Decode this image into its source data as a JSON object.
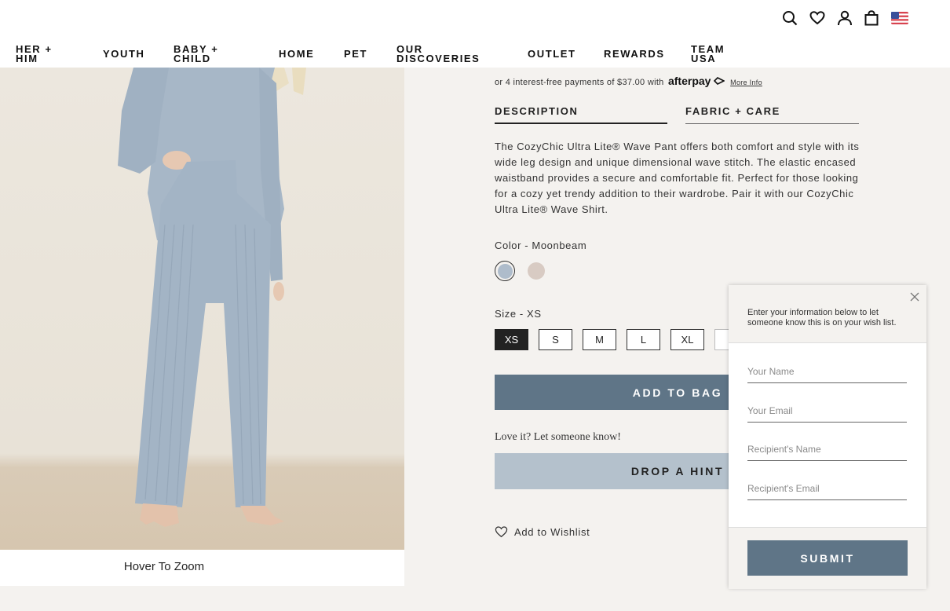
{
  "header": {
    "icons": [
      "search-icon",
      "heart-icon",
      "account-icon",
      "bag-icon",
      "us-flag-icon"
    ],
    "nav": [
      {
        "line1": "HER +",
        "line2": "HIM"
      },
      {
        "line1": "YOUTH",
        "line2": ""
      },
      {
        "line1": "BABY +",
        "line2": "CHILD"
      },
      {
        "line1": "HOME",
        "line2": ""
      },
      {
        "line1": "PET",
        "line2": ""
      },
      {
        "line1": "OUR",
        "line2": "DISCOVERIES"
      },
      {
        "line1": "OUTLET",
        "line2": ""
      },
      {
        "line1": "REWARDS",
        "line2": ""
      },
      {
        "line1": "TEAM",
        "line2": "USA"
      }
    ]
  },
  "gallery": {
    "hover_text": "Hover To Zoom"
  },
  "product": {
    "payments_text": "or 4 interest-free payments of $37.00 with",
    "afterpay": "afterpay",
    "more_info": "More Info",
    "tabs": [
      "DESCRIPTION",
      "FABRIC + CARE"
    ],
    "description": "The CozyChic Ultra Lite® Wave Pant offers both comfort and style with its wide leg design and unique dimensional wave stitch. The elastic encased waistband provides a secure and comfortable fit. Perfect for those looking for a cozy yet trendy addition to their wardrobe. Pair it with our CozyChic Ultra Lite® Wave Shirt.",
    "color_label": "Color - Moonbeam",
    "colors": [
      {
        "name": "moonbeam",
        "hex": "#aebccb",
        "selected": true
      },
      {
        "name": "taupe",
        "hex": "#d8cbc3",
        "selected": false
      }
    ],
    "size_label": "Size - XS",
    "sizes": [
      {
        "label": "XS",
        "selected": true
      },
      {
        "label": "S",
        "selected": false
      },
      {
        "label": "M",
        "selected": false
      },
      {
        "label": "L",
        "selected": false
      },
      {
        "label": "XL",
        "selected": false
      }
    ],
    "add_to_bag": "ADD TO BAG",
    "love_text": "Love it? Let someone know!",
    "drop_hint": "DROP A HINT",
    "wishlist": "Add to Wishlist"
  },
  "hint_modal": {
    "intro": "Enter your information below to let someone know this is on your wish list.",
    "fields": [
      {
        "placeholder": "Your Name",
        "value": ""
      },
      {
        "placeholder": "Your Email",
        "value": ""
      },
      {
        "placeholder": "Recipient's Name",
        "value": ""
      },
      {
        "placeholder": "Recipient's Email",
        "value": ""
      }
    ],
    "submit": "SUBMIT"
  },
  "colors": {
    "primary_button": "#5f7587",
    "secondary_button": "#b4c1cc",
    "selected_size": "#222222"
  }
}
